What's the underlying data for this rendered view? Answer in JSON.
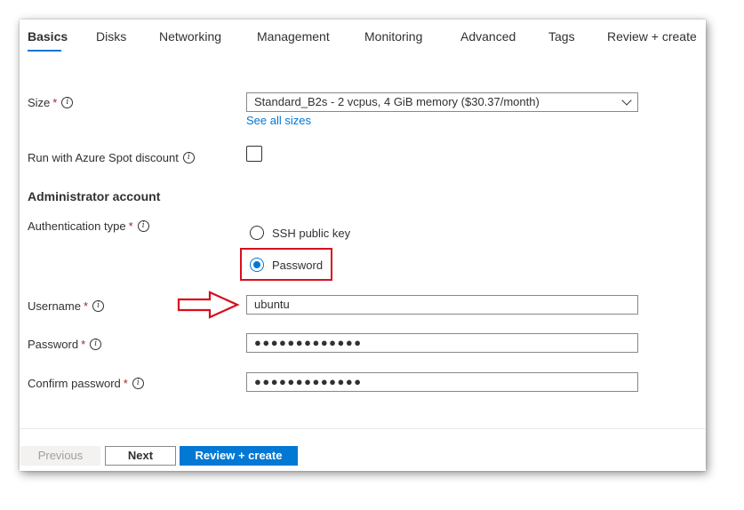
{
  "tabs": [
    {
      "label": "Basics",
      "active": true
    },
    {
      "label": "Disks"
    },
    {
      "label": "Networking"
    },
    {
      "label": "Management"
    },
    {
      "label": "Monitoring"
    },
    {
      "label": "Advanced"
    },
    {
      "label": "Tags"
    },
    {
      "label": "Review + create"
    }
  ],
  "size": {
    "label": "Size",
    "required_mark": "*",
    "value": "Standard_B2s - 2 vcpus, 4 GiB memory ($30.37/month)",
    "see_all_link": "See all sizes"
  },
  "spot": {
    "label": "Run with Azure Spot discount",
    "checked": false
  },
  "admin": {
    "section_title": "Administrator account",
    "auth_label": "Authentication type",
    "required_mark": "*",
    "options": [
      {
        "label": "SSH public key",
        "selected": false
      },
      {
        "label": "Password",
        "selected": true
      }
    ]
  },
  "username": {
    "label": "Username",
    "required_mark": "*",
    "value": "ubuntu"
  },
  "password": {
    "label": "Password",
    "required_mark": "*",
    "value": "●●●●●●●●●●●●●"
  },
  "confirm_password": {
    "label": "Confirm password",
    "required_mark": "*",
    "value": "●●●●●●●●●●●●●"
  },
  "footer": {
    "previous_label": "Previous",
    "next_label": "Next",
    "review_label": "Review + create"
  },
  "colors": {
    "accent": "#0078d4",
    "annotation_red": "#d70f1c",
    "required_red": "#a4262c"
  },
  "icons": {
    "info": "info-icon",
    "dropdown": "chevron-down-icon",
    "annotation_arrow": "arrow-right-icon"
  },
  "info_glyph": "i"
}
